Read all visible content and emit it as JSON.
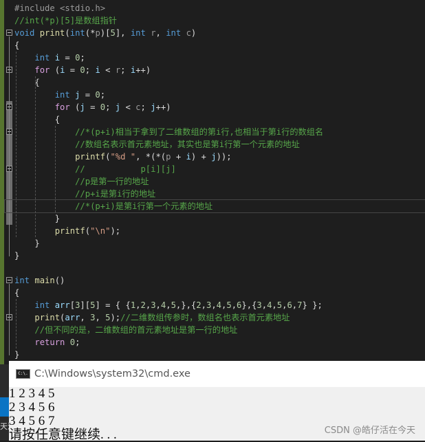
{
  "editor": {
    "current_line": 16,
    "fold_lines": [
      2,
      5,
      8,
      10,
      13,
      22,
      25
    ],
    "lines": [
      [
        [
          "#include <stdio.h>",
          "pp"
        ]
      ],
      [
        [
          "//int(*p)[5]是数组指针",
          "cm"
        ]
      ],
      [
        [
          "void",
          "kw"
        ],
        [
          " ",
          "pn"
        ],
        [
          "print",
          "fn"
        ],
        [
          "(",
          "pn"
        ],
        [
          "int",
          "kw"
        ],
        [
          "(*",
          "pn"
        ],
        [
          "p",
          "par"
        ],
        [
          ")[",
          "pn"
        ],
        [
          "5",
          "num"
        ],
        [
          "], ",
          "pn"
        ],
        [
          "int",
          "kw"
        ],
        [
          " ",
          "pn"
        ],
        [
          "r",
          "par"
        ],
        [
          ", ",
          "pn"
        ],
        [
          "int",
          "kw"
        ],
        [
          " ",
          "pn"
        ],
        [
          "c",
          "par"
        ],
        [
          ")",
          "pn"
        ]
      ],
      [
        [
          "{",
          "pn"
        ]
      ],
      [
        [
          "    ",
          "pn"
        ],
        [
          "int",
          "kw"
        ],
        [
          " ",
          "pn"
        ],
        [
          "i",
          "var"
        ],
        [
          " = ",
          "pn"
        ],
        [
          "0",
          "num"
        ],
        [
          ";",
          "pn"
        ]
      ],
      [
        [
          "    ",
          "pn"
        ],
        [
          "for",
          "ctl"
        ],
        [
          " (",
          "pn"
        ],
        [
          "i",
          "var"
        ],
        [
          " = ",
          "pn"
        ],
        [
          "0",
          "num"
        ],
        [
          "; ",
          "pn"
        ],
        [
          "i",
          "var"
        ],
        [
          " < ",
          "pn"
        ],
        [
          "r",
          "par"
        ],
        [
          "; ",
          "pn"
        ],
        [
          "i",
          "var"
        ],
        [
          "++)",
          "pn"
        ]
      ],
      [
        [
          "    {",
          "pn"
        ]
      ],
      [
        [
          "        ",
          "pn"
        ],
        [
          "int",
          "kw"
        ],
        [
          " ",
          "pn"
        ],
        [
          "j",
          "var"
        ],
        [
          " = ",
          "pn"
        ],
        [
          "0",
          "num"
        ],
        [
          ";",
          "pn"
        ]
      ],
      [
        [
          "        ",
          "pn"
        ],
        [
          "for",
          "ctl"
        ],
        [
          " (",
          "pn"
        ],
        [
          "j",
          "var"
        ],
        [
          " = ",
          "pn"
        ],
        [
          "0",
          "num"
        ],
        [
          "; ",
          "pn"
        ],
        [
          "j",
          "var"
        ],
        [
          " < ",
          "pn"
        ],
        [
          "c",
          "par"
        ],
        [
          "; ",
          "pn"
        ],
        [
          "j",
          "var"
        ],
        [
          "++)",
          "pn"
        ]
      ],
      [
        [
          "        {",
          "pn"
        ]
      ],
      [
        [
          "            ",
          "pn"
        ],
        [
          "//*(p+i)相当于拿到了二维数组的第i行,也相当于第i行的数组名",
          "cm"
        ]
      ],
      [
        [
          "            ",
          "pn"
        ],
        [
          "//数组名表示首元素地址，其实也是第i行第一个元素的地址",
          "cm"
        ]
      ],
      [
        [
          "            ",
          "pn"
        ],
        [
          "printf",
          "fn"
        ],
        [
          "(",
          "pn"
        ],
        [
          "\"%d \"",
          "str"
        ],
        [
          ", *(*(",
          "pn"
        ],
        [
          "p",
          "par"
        ],
        [
          " + ",
          "pn"
        ],
        [
          "i",
          "var"
        ],
        [
          ") + ",
          "pn"
        ],
        [
          "j",
          "var"
        ],
        [
          "));",
          "pn"
        ]
      ],
      [
        [
          "            ",
          "pn"
        ],
        [
          "//           p[i][j]",
          "cm"
        ]
      ],
      [
        [
          "            ",
          "pn"
        ],
        [
          "//p是第一行的地址",
          "cm"
        ]
      ],
      [
        [
          "            ",
          "pn"
        ],
        [
          "//p+i是第i行的地址",
          "cm"
        ]
      ],
      [
        [
          "            ",
          "pn"
        ],
        [
          "//*(p+i)是第i行第一个元素的地址",
          "cm"
        ]
      ],
      [
        [
          "        }",
          "pn"
        ]
      ],
      [
        [
          "        ",
          "pn"
        ],
        [
          "printf",
          "fn"
        ],
        [
          "(",
          "pn"
        ],
        [
          "\"\\n\"",
          "str"
        ],
        [
          ");",
          "pn"
        ]
      ],
      [
        [
          "    }",
          "pn"
        ]
      ],
      [
        [
          "}",
          "pn"
        ]
      ],
      [
        [
          "",
          "pn"
        ]
      ],
      [
        [
          "int",
          "kw"
        ],
        [
          " ",
          "pn"
        ],
        [
          "main",
          "fn"
        ],
        [
          "()",
          "pn"
        ]
      ],
      [
        [
          "{",
          "pn"
        ]
      ],
      [
        [
          "    ",
          "pn"
        ],
        [
          "int",
          "kw"
        ],
        [
          " ",
          "pn"
        ],
        [
          "arr",
          "var"
        ],
        [
          "[",
          "pn"
        ],
        [
          "3",
          "num"
        ],
        [
          "][",
          "pn"
        ],
        [
          "5",
          "num"
        ],
        [
          "] = { {",
          "pn"
        ],
        [
          "1",
          "num"
        ],
        [
          ",",
          "pn"
        ],
        [
          "2",
          "num"
        ],
        [
          ",",
          "pn"
        ],
        [
          "3",
          "num"
        ],
        [
          ",",
          "pn"
        ],
        [
          "4",
          "num"
        ],
        [
          ",",
          "pn"
        ],
        [
          "5",
          "num"
        ],
        [
          ",},{",
          "pn"
        ],
        [
          "2",
          "num"
        ],
        [
          ",",
          "pn"
        ],
        [
          "3",
          "num"
        ],
        [
          ",",
          "pn"
        ],
        [
          "4",
          "num"
        ],
        [
          ",",
          "pn"
        ],
        [
          "5",
          "num"
        ],
        [
          ",",
          "pn"
        ],
        [
          "6",
          "num"
        ],
        [
          "},{",
          "pn"
        ],
        [
          "3",
          "num"
        ],
        [
          ",",
          "pn"
        ],
        [
          "4",
          "num"
        ],
        [
          ",",
          "pn"
        ],
        [
          "5",
          "num"
        ],
        [
          ",",
          "pn"
        ],
        [
          "6",
          "num"
        ],
        [
          ",",
          "pn"
        ],
        [
          "7",
          "num"
        ],
        [
          "} };",
          "pn"
        ]
      ],
      [
        [
          "    ",
          "pn"
        ],
        [
          "print",
          "fn"
        ],
        [
          "(",
          "pn"
        ],
        [
          "arr",
          "var"
        ],
        [
          ", ",
          "pn"
        ],
        [
          "3",
          "num"
        ],
        [
          ", ",
          "pn"
        ],
        [
          "5",
          "num"
        ],
        [
          ");",
          "pn"
        ],
        [
          "//二维数组传参时，数组名也表示首元素地址",
          "cm"
        ]
      ],
      [
        [
          "    ",
          "pn"
        ],
        [
          "//但不同的是，二维数组的首元素地址是第一行的地址",
          "cm"
        ]
      ],
      [
        [
          "    ",
          "pn"
        ],
        [
          "return",
          "ctl"
        ],
        [
          " ",
          "pn"
        ],
        [
          "0",
          "num"
        ],
        [
          ";",
          "pn"
        ]
      ],
      [
        [
          "}",
          "pn"
        ]
      ]
    ]
  },
  "console": {
    "title": "C:\\Windows\\system32\\cmd.exe",
    "icon_text": "C:\\.",
    "output": [
      "1 2 3 4 5",
      "2 3 4 5 6",
      "3 4 5 6 7",
      "请按任意键继续. . ."
    ]
  },
  "taskbar": {
    "fragment": "天源"
  },
  "watermark": "CSDN @皓仔活在今天"
}
